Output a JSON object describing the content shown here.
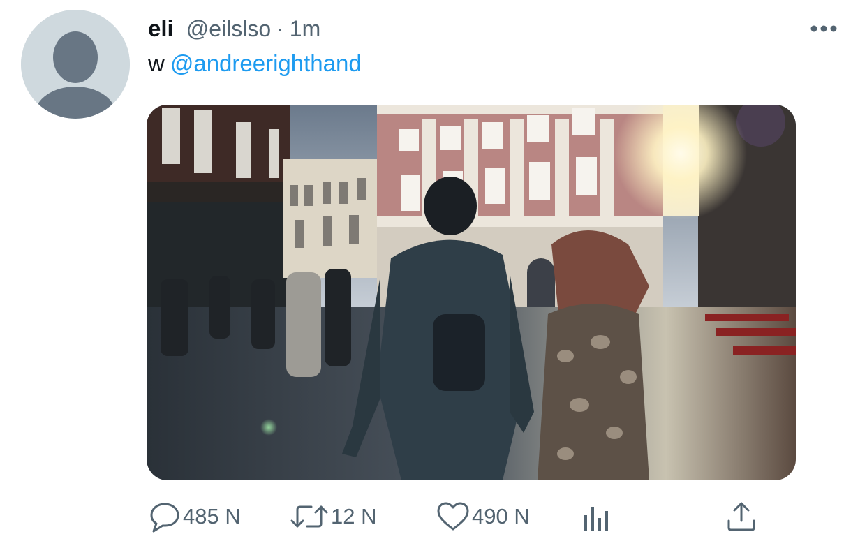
{
  "tweet": {
    "display_name": "eli",
    "handle": "@eilslso",
    "separator": "·",
    "timestamp": "1m",
    "text_prefix": "w",
    "mention": "@andreerighthand",
    "avatar_icon": "default-profile-icon",
    "more_icon": "more-horizontal-icon",
    "media_description": "Couple walking hand in hand on a wet cobblestone square toward the sunlit buildings"
  },
  "actions": {
    "reply": {
      "icon": "reply-icon",
      "count": "485 N"
    },
    "retweet": {
      "icon": "retweet-icon",
      "count": "12 N"
    },
    "like": {
      "icon": "heart-icon",
      "count": "490 N"
    },
    "analytics": {
      "icon": "analytics-icon"
    },
    "share": {
      "icon": "share-icon"
    }
  },
  "colors": {
    "text_primary": "#0f1419",
    "text_secondary": "#536471",
    "link": "#1d9bf0",
    "avatar_bg": "#cfd9de",
    "avatar_fg": "#657786"
  }
}
